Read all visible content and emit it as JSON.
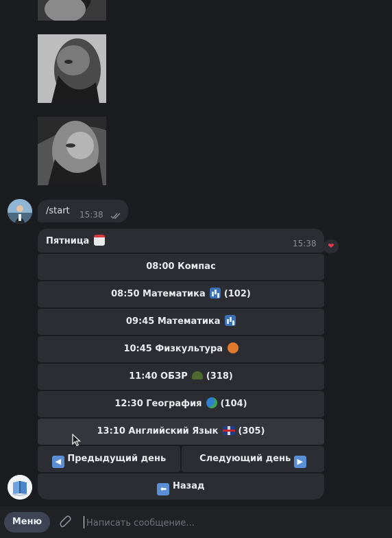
{
  "stickers": [
    {
      "name": "sticker-photo-1"
    },
    {
      "name": "sticker-photo-2"
    },
    {
      "name": "sticker-photo-3"
    }
  ],
  "user_message": {
    "text": "/start",
    "time": "15:38"
  },
  "bot_message": {
    "text": "Пятница",
    "emoji": "calendar-icon",
    "time": "15:38",
    "reaction": "❤"
  },
  "keyboard": {
    "rows": [
      {
        "label": "08:00 Компас"
      },
      {
        "label": "08:50 Математика",
        "emoji": "chart-icon",
        "suffix": "(102)"
      },
      {
        "label": "09:45 Математика",
        "emoji": "chart-icon",
        "suffix": ""
      },
      {
        "label": "10:45 Физкультура",
        "emoji": "basketball-icon",
        "suffix": ""
      },
      {
        "label": "11:40 ОБЗР",
        "emoji": "helmet-icon",
        "suffix": "(318)"
      },
      {
        "label": "12:30 География",
        "emoji": "globe-icon",
        "suffix": "(104)"
      },
      {
        "label": "13:10 Английский Язык",
        "emoji": "uk-flag-icon",
        "suffix": "(305)"
      }
    ],
    "prev_day": {
      "arrow": "◀",
      "label": "Предыдущий день"
    },
    "next_day": {
      "label": "Следующий день",
      "arrow": "▶"
    },
    "back": {
      "arrow": "⬅",
      "label": "Назад"
    }
  },
  "input_bar": {
    "menu_label": "Меню",
    "placeholder": "Написать сообщение..."
  },
  "colors": {
    "background": "#1b1c1f",
    "bubble": "#2b2d33",
    "accent": "#5a8fd6"
  }
}
